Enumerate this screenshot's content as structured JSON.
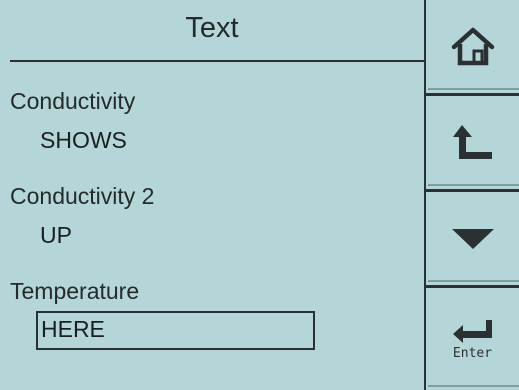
{
  "screen": {
    "title": "Text"
  },
  "parameters": [
    {
      "label": "Conductivity",
      "value": "SHOWS"
    },
    {
      "label": "Conductivity 2",
      "value": "UP"
    },
    {
      "label": "Temperature",
      "value": "HERE"
    }
  ],
  "softkeys": {
    "home": {
      "icon": "home-icon"
    },
    "back": {
      "icon": "return-arrow-icon"
    },
    "down": {
      "icon": "down-triangle-icon"
    },
    "enter": {
      "icon": "enter-arrow-icon",
      "label": "Enter"
    }
  },
  "colors": {
    "background": "#b4d6d8",
    "foreground": "#252a2b"
  }
}
